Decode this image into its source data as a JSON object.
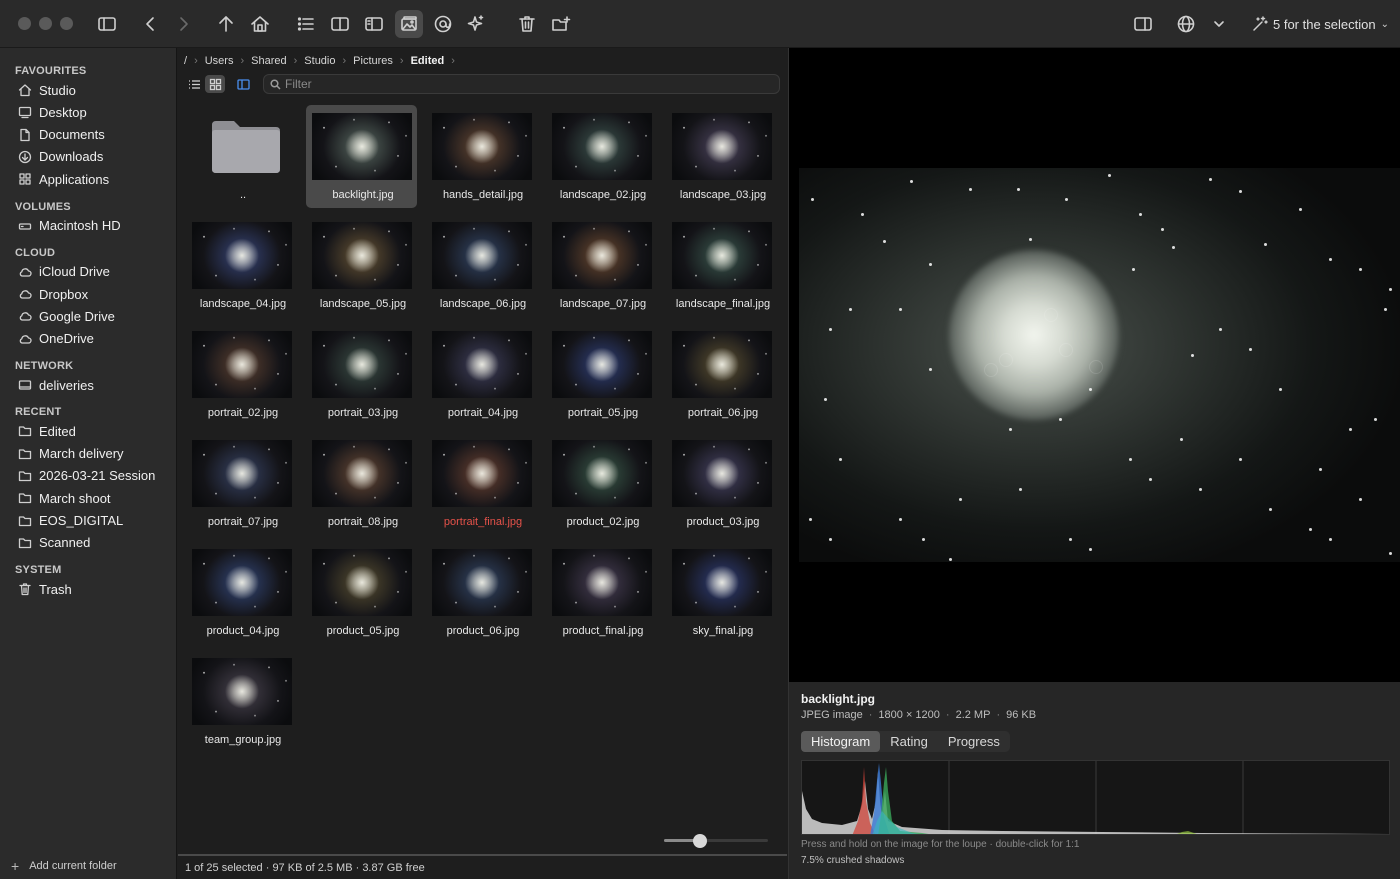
{
  "toolbar": {
    "selection_label": "5 for the selection",
    "icons": [
      "sidebar-icon",
      "back-icon",
      "forward-icon",
      "up-icon",
      "home-icon",
      "list-icon",
      "columns-icon",
      "panel-icon",
      "preview-icon",
      "at-icon",
      "sparkle-icon",
      "trash-icon",
      "new-folder-icon",
      "inspector-icon",
      "globe-icon",
      "chevron-down-icon",
      "magic-wand-icon"
    ]
  },
  "sidebar": {
    "sections": [
      {
        "title": "FAVOURITES",
        "items": [
          {
            "label": "Studio",
            "icon": "home-icon"
          },
          {
            "label": "Desktop",
            "icon": "desktop-icon"
          },
          {
            "label": "Documents",
            "icon": "document-icon"
          },
          {
            "label": "Downloads",
            "icon": "download-icon"
          },
          {
            "label": "Applications",
            "icon": "apps-icon"
          }
        ]
      },
      {
        "title": "VOLUMES",
        "items": [
          {
            "label": "Macintosh HD",
            "icon": "drive-icon"
          }
        ]
      },
      {
        "title": "CLOUD",
        "items": [
          {
            "label": "iCloud Drive",
            "icon": "cloud-icon"
          },
          {
            "label": "Dropbox",
            "icon": "cloud-icon"
          },
          {
            "label": "Google Drive",
            "icon": "cloud-icon"
          },
          {
            "label": "OneDrive",
            "icon": "cloud-icon"
          }
        ]
      },
      {
        "title": "NETWORK",
        "items": [
          {
            "label": "deliveries",
            "icon": "network-drive-icon"
          }
        ]
      },
      {
        "title": "RECENT",
        "items": [
          {
            "label": "Edited",
            "icon": "folder-icon"
          },
          {
            "label": "March delivery",
            "icon": "folder-icon"
          },
          {
            "label": "2026-03-21 Session",
            "icon": "folder-icon"
          },
          {
            "label": "March shoot",
            "icon": "folder-icon"
          },
          {
            "label": "EOS_DIGITAL",
            "icon": "folder-icon"
          },
          {
            "label": "Scanned",
            "icon": "folder-icon"
          }
        ]
      },
      {
        "title": "SYSTEM",
        "items": [
          {
            "label": "Trash",
            "icon": "trash-icon"
          }
        ]
      }
    ],
    "add_folder_label": "Add current folder"
  },
  "browser": {
    "breadcrumb": [
      "/",
      "Users",
      "Shared",
      "Studio",
      "Pictures",
      "Edited"
    ],
    "filter_placeholder": "Filter",
    "files": [
      {
        "name": "..",
        "type": "folder",
        "tint": "none"
      },
      {
        "name": "backlight.jpg",
        "selected": true,
        "tint": "#5a6a62"
      },
      {
        "name": "hands_detail.jpg",
        "tint": "#6a4a34"
      },
      {
        "name": "landscape_02.jpg",
        "tint": "#3e5650"
      },
      {
        "name": "landscape_03.jpg",
        "tint": "#4e4660"
      },
      {
        "name": "landscape_04.jpg",
        "tint": "#38467a"
      },
      {
        "name": "landscape_05.jpg",
        "tint": "#6a5636"
      },
      {
        "name": "landscape_06.jpg",
        "tint": "#34486a"
      },
      {
        "name": "landscape_07.jpg",
        "tint": "#6e4a30"
      },
      {
        "name": "landscape_final.jpg",
        "tint": "#3c5a50"
      },
      {
        "name": "portrait_02.jpg",
        "tint": "#5e4232"
      },
      {
        "name": "portrait_03.jpg",
        "tint": "#3c5048"
      },
      {
        "name": "portrait_04.jpg",
        "tint": "#40405e"
      },
      {
        "name": "portrait_05.jpg",
        "tint": "#30407a"
      },
      {
        "name": "portrait_06.jpg",
        "tint": "#5e5232"
      },
      {
        "name": "portrait_07.jpg",
        "tint": "#384466"
      },
      {
        "name": "portrait_08.jpg",
        "tint": "#6a4a36"
      },
      {
        "name": "portrait_final.jpg",
        "tint": "#6c4232",
        "label_color": "red"
      },
      {
        "name": "product_02.jpg",
        "tint": "#3a5a4a"
      },
      {
        "name": "product_03.jpg",
        "tint": "#484466"
      },
      {
        "name": "product_04.jpg",
        "tint": "#34487a"
      },
      {
        "name": "product_05.jpg",
        "tint": "#5a5032"
      },
      {
        "name": "product_06.jpg",
        "tint": "#34486a"
      },
      {
        "name": "product_final.jpg",
        "tint": "#4a4058"
      },
      {
        "name": "sky_final.jpg",
        "tint": "#303e7a"
      },
      {
        "name": "team_group.jpg",
        "tint": "#4a4450"
      }
    ],
    "thumbnail_zoom": 0.35,
    "status": "1 of 25 selected · 97 KB of 2.5 MB · 3.87 GB free"
  },
  "preview": {
    "filename": "backlight.jpg",
    "meta": [
      "JPEG image",
      "1800 × 1200",
      "2.2 MP",
      "96 KB"
    ],
    "tabs": [
      {
        "label": "Histogram",
        "active": true
      },
      {
        "label": "Rating",
        "active": false
      },
      {
        "label": "Progress",
        "active": false
      }
    ],
    "hint": "Press and hold on the image for the loupe · double-click for 1:1",
    "shadow_note": "7.5% crushed shadows"
  }
}
